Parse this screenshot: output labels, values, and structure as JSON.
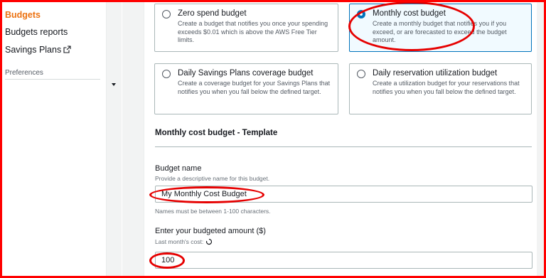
{
  "sidebar": {
    "items": [
      {
        "label": "Budgets",
        "active": true
      },
      {
        "label": "Budgets reports",
        "active": false
      },
      {
        "label": "Savings Plans",
        "active": false,
        "icon": "external-link-icon"
      }
    ],
    "preferences_label": "Preferences"
  },
  "budget_types": [
    {
      "title": "Zero spend budget",
      "description": "Create a budget that notifies you once your spending exceeds $0.01 which is above the AWS Free Tier limits.",
      "selected": false
    },
    {
      "title": "Monthly cost budget",
      "description": "Create a monthly budget that notifies you if you exceed, or are forecasted to exceed the budget amount.",
      "selected": true
    },
    {
      "title": "Daily Savings Plans coverage budget",
      "description": "Create a coverage budget for your Savings Plans that notifies you when you fall below the defined target.",
      "selected": false
    },
    {
      "title": "Daily reservation utilization budget",
      "description": "Create a utilization budget for your reservations that notifies you when you fall below the defined target.",
      "selected": false
    }
  ],
  "template": {
    "section_title": "Monthly cost budget - Template",
    "budget_name": {
      "label": "Budget name",
      "description": "Provide a descriptive name for this budget.",
      "value": "My Monthly Cost Budget",
      "hint": "Names must be between 1-100 characters."
    },
    "budget_amount": {
      "label": "Enter your budgeted amount ($)",
      "description": "Last month's cost:",
      "value": "100"
    }
  },
  "colors": {
    "accent": "#ec7211",
    "selected_border": "#0073bb",
    "annotation": "#e60000"
  }
}
